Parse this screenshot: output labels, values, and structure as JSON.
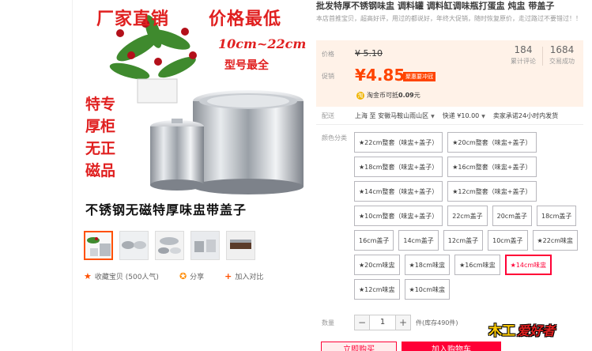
{
  "image_overlay": {
    "top_left": "厂家直销",
    "top_right": "价格最低",
    "size_range": "10cm~22cm",
    "model": "型号最全",
    "side_text": [
      "特专",
      "厚柜",
      "无正",
      "磁品"
    ],
    "bottom": "不锈钢无磁特厚味盅带盖子"
  },
  "actions": {
    "favorite": "收藏宝贝 (500人气)",
    "share": "分享",
    "compare": "加入对比"
  },
  "product": {
    "title": "批发特厚不锈钢味盅 调料罐 调料缸调味瓶打蛋盅 炖盅 带盖子",
    "subtitle": "本店首推宝贝，超高好评，用过的都说好，年终大促销，随时恢复原价，走过路过不要错过！！"
  },
  "price": {
    "orig_label": "价格",
    "orig_value": "¥ 5.10",
    "promo_label": "促销",
    "promo_value": "¥4.85",
    "promo_badge": "聚惠要冲冠",
    "reviews_count": "184",
    "reviews_label": "累计评论",
    "sold_count": "1684",
    "sold_label": "交易成功"
  },
  "coins": {
    "icon": "淘",
    "prefix": "淘金币可抵",
    "amount": "0.09",
    "suffix": "元"
  },
  "shipping": {
    "label": "配送",
    "route": "上海 至  安徽马鞍山雨山区",
    "fee": "快递 ¥10.00",
    "promise": "卖家承诺24小时内发货"
  },
  "color": {
    "label": "颜色分类",
    "options": [
      "★22cm整套（味盅+盖子）",
      "★20cm整套（味盅+盖子）",
      "★18cm整套（味盅+盖子）",
      "★16cm整套（味盅+盖子）",
      "★14cm整套（味盅+盖子）",
      "★12cm整套（味盅+盖子）",
      "★10cm整套（味盅+盖子）",
      "22cm盖子",
      "20cm盖子",
      "18cm盖子",
      "16cm盖子",
      "14cm盖子",
      "12cm盖子",
      "10cm盖子",
      "★22cm味盅",
      "★20cm味盅",
      "★18cm味盅",
      "★16cm味盅",
      "★14cm味盅",
      "★12cm味盅",
      "★10cm味盅"
    ],
    "selected_index": 18
  },
  "quantity": {
    "label": "数量",
    "minus": "−",
    "value": "1",
    "plus": "+",
    "stock": "件(库存490件)"
  },
  "buttons": {
    "buy_now": "立即购买",
    "add_to_cart": "加入购物车"
  },
  "watermark": {
    "a": "木工",
    "b": "爱好者"
  },
  "colors": {
    "accent": "#ff4400",
    "tmall_red": "#ff0036",
    "price_bg": "#fff2e8"
  }
}
